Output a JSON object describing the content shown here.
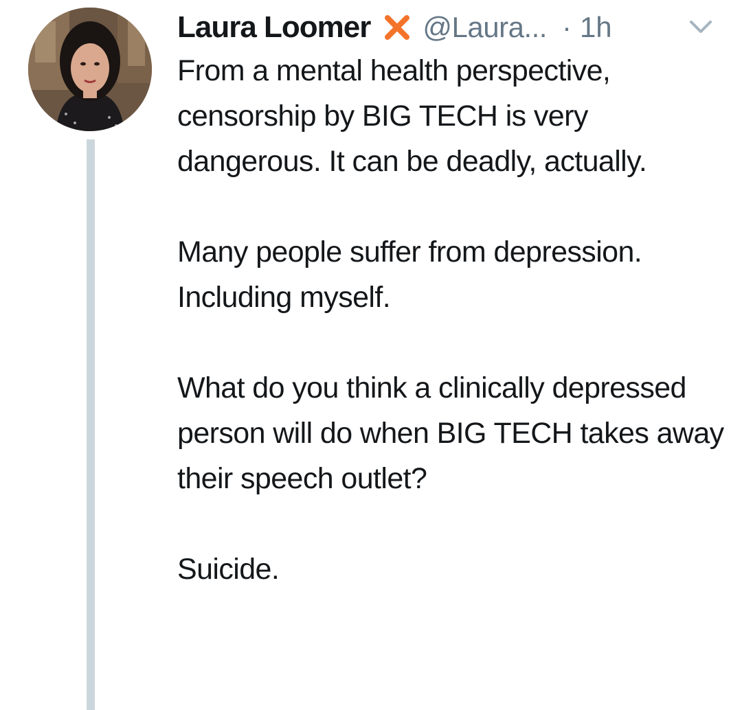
{
  "tweet": {
    "author_name": "Laura Loomer",
    "handle": "@Laura...",
    "separator": "·",
    "time": "1h",
    "paragraphs": [
      "From a mental health perspective, censorship by BIG TECH is very dangerous. It can be deadly, actually.",
      "Many people suffer from depression. Including myself.",
      "What do you think a clinically depressed person will do when BIG TECH takes away their speech outlet?",
      "Suicide."
    ]
  },
  "icons": {
    "badge": "orange-x-icon",
    "menu": "chevron-down-icon"
  },
  "colors": {
    "text": "#14171a",
    "secondary_text": "#657786",
    "thread_line": "#ccd6dd",
    "badge": "#f4732b"
  }
}
